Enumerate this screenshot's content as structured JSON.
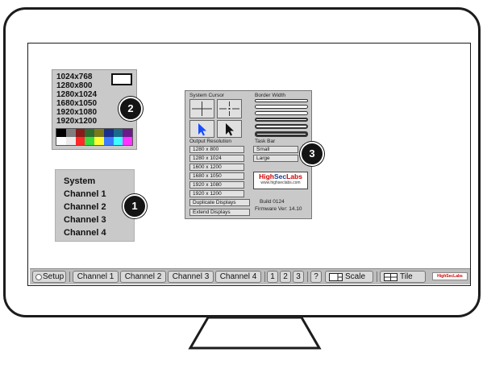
{
  "resolution_menu": {
    "items": [
      "1024x768",
      "1280x800",
      "1280x1024",
      "1680x1050",
      "1920x1080",
      "1920x1200"
    ],
    "palette_top": [
      "#000000",
      "#7f7f7f",
      "#8b1a1a",
      "#2e6b2e",
      "#7a7a1a",
      "#1a2e8b",
      "#1a6b8b",
      "#6b1a8b"
    ],
    "palette_bottom": [
      "#ffffff",
      "#ececec",
      "#ff2a2a",
      "#3ddc3d",
      "#ffff33",
      "#3d7bff",
      "#3dffff",
      "#ff33ff"
    ]
  },
  "channel_menu": {
    "items": [
      "System",
      "Channel 1",
      "Channel 2",
      "Channel 3",
      "Channel 4"
    ]
  },
  "badges": {
    "one": "1",
    "two": "2",
    "three": "3"
  },
  "settings": {
    "system_cursor_label": "System Cursor",
    "border_width_label": "Border Width",
    "output_resolution_label": "Output Resolution",
    "task_bar_label": "Task Bar",
    "resolutions": [
      "1280 x 800",
      "1280 x 1024",
      "1600 x 1200",
      "1680 x 1050",
      "1920 x 1080",
      "1920 x 1200"
    ],
    "duplicate_label": "Duplicate Displays",
    "extend_label": "Extend Displays",
    "taskbar_options": [
      "Small",
      "Large"
    ],
    "logo_high": "High",
    "logo_sec": "Sec",
    "logo_labs": "Labs",
    "logo_url": "www.highseclabs.com",
    "build": "Build 0124",
    "firmware": "Firmware Ver: 14.10"
  },
  "taskbar": {
    "setup": "Setup",
    "channels": [
      "Channel 1",
      "Channel 2",
      "Channel 3",
      "Channel 4"
    ],
    "numbers": [
      "1",
      "2",
      "3"
    ],
    "help": "?",
    "scale": "Scale",
    "tile": "Tile",
    "logo": "HighSecLabs"
  },
  "colors": {
    "brand_red": "#cc0000",
    "brand_blue": "#1a3d8b",
    "cursor_blue": "#1a4dff"
  }
}
